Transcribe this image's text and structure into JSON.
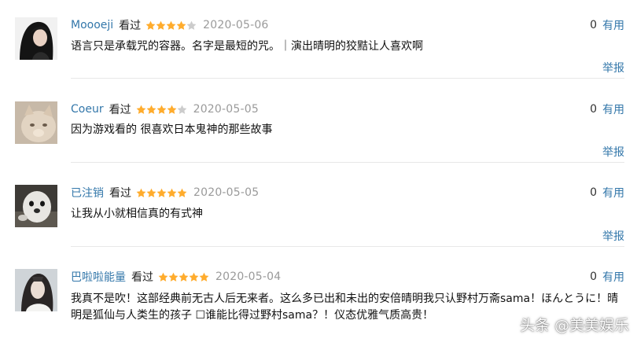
{
  "reviews": [
    {
      "username": "Moooeji",
      "status": "看过",
      "rating": 4,
      "date": "2020-05-06",
      "votes": "0",
      "vote_label": "有用",
      "content": "语言只是承载咒的容器。名字是最短的咒。｜演出晴明的狡黠让人喜欢啊",
      "report_label": "举报",
      "avatar_icon": "woman-portrait-avatar"
    },
    {
      "username": "Coeur",
      "status": "看过",
      "rating": 4,
      "date": "2020-05-05",
      "votes": "0",
      "vote_label": "有用",
      "content": "因为游戏看的 很喜欢日本鬼神的那些故事",
      "report_label": "举报",
      "avatar_icon": "cat-avatar"
    },
    {
      "username": "已注销",
      "status": "看过",
      "rating": 5,
      "date": "2020-05-05",
      "votes": "0",
      "vote_label": "有用",
      "content": "让我从小就相信真的有式神",
      "report_label": "举报",
      "avatar_icon": "seal-avatar"
    },
    {
      "username": "巴啦啦能量",
      "status": "看过",
      "rating": 5,
      "date": "2020-05-04",
      "votes": "0",
      "vote_label": "有用",
      "content": "我真不是吹！这部经典前无古人后无来者。这么多已出和未出的安倍晴明我只认野村万斋sama！ほんとうに！晴明是狐仙与人类生的孩子 ☐谁能比得过野村sama？！仪态优雅气质高贵！",
      "report_label": "举报",
      "avatar_icon": "costume-portrait-avatar"
    }
  ],
  "watermark": "头条 @美美娱乐",
  "colors": {
    "link": "#3377aa",
    "date": "#9a9a9a",
    "star_filled": "#ffac2d",
    "star_empty": "#cccccc",
    "divider": "#e8e8e8"
  }
}
